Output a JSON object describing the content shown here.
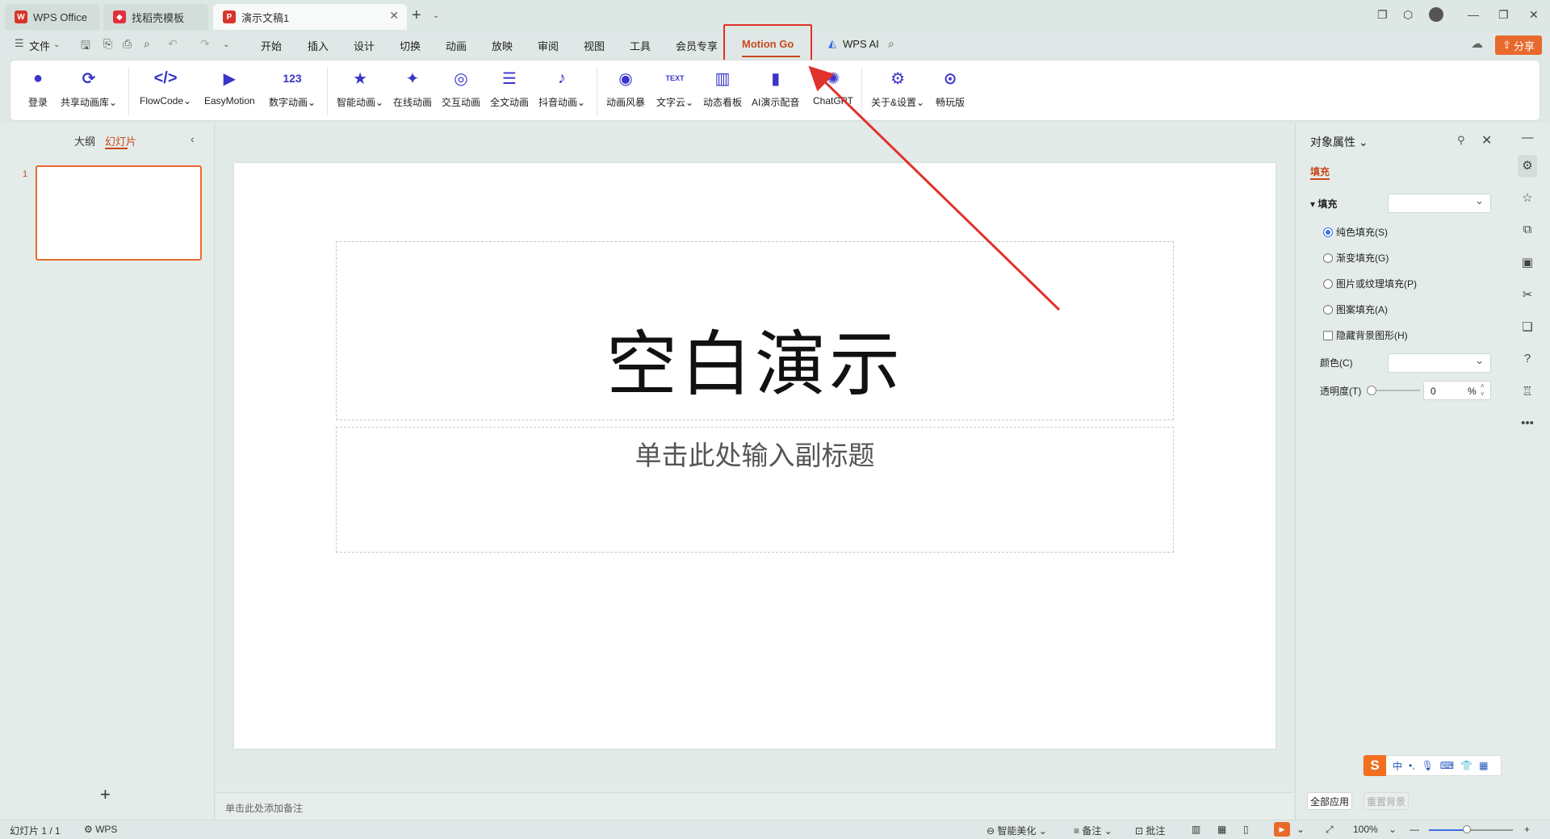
{
  "tabs": [
    {
      "label": "WPS Office",
      "icon": "wps-logo-icon",
      "color": "#d7342b"
    },
    {
      "label": "找稻壳模板",
      "icon": "docer-icon",
      "color": "#e0313b"
    },
    {
      "label": "演示文稿1",
      "icon": "presentation-icon",
      "color": "#d7342b"
    }
  ],
  "menu": {
    "file": "文件",
    "items": [
      "开始",
      "插入",
      "设计",
      "切换",
      "动画",
      "放映",
      "审阅",
      "视图",
      "工具",
      "会员专享"
    ],
    "active": "Motion Go",
    "wps_ai": "WPS AI",
    "share": "分享"
  },
  "ribbon": {
    "groups": [
      [
        {
          "label": "登录",
          "icon": "user-icon"
        },
        {
          "label": "共享动画库",
          "icon": "share-nodes-icon",
          "dropdown": true
        }
      ],
      [
        {
          "label": "FlowCode",
          "icon": "code-icon",
          "dropdown": true
        },
        {
          "label": "EasyMotion",
          "icon": "video-icon"
        },
        {
          "label": "数字动画",
          "icon": "number-icon",
          "dropdown": true
        }
      ],
      [
        {
          "label": "智能动画",
          "icon": "star-icon",
          "dropdown": true
        },
        {
          "label": "在线动画",
          "icon": "online-anim-icon"
        },
        {
          "label": "交互动画",
          "icon": "interactive-icon"
        },
        {
          "label": "全文动画",
          "icon": "fulltext-anim-icon"
        },
        {
          "label": "抖音动画",
          "icon": "tiktok-icon",
          "dropdown": true
        }
      ],
      [
        {
          "label": "动画风暴",
          "icon": "storm-icon"
        },
        {
          "label": "文字云",
          "icon": "text-cloud-icon",
          "dropdown": true
        },
        {
          "label": "动态看板",
          "icon": "dashboard-icon"
        },
        {
          "label": "AI演示配音",
          "icon": "voice-icon"
        },
        {
          "label": "ChatGPT",
          "icon": "chatgpt-icon"
        }
      ],
      [
        {
          "label": "关于&设置",
          "icon": "settings-icon",
          "dropdown": true
        },
        {
          "label": "畅玩版",
          "icon": "toggle-icon"
        }
      ]
    ]
  },
  "left_panel": {
    "tab_outline": "大纲",
    "tab_slides": "幻灯片",
    "slide_number": "1"
  },
  "slide": {
    "title": "空白演示",
    "subtitle": "单击此处输入副标题"
  },
  "notes_placeholder": "单击此处添加备注",
  "properties": {
    "title": "对象属性",
    "tab": "填充",
    "section": "填充",
    "options": [
      "纯色填充(S)",
      "渐变填充(G)",
      "图片或纹理填充(P)",
      "图案填充(A)"
    ],
    "selected_option": "纯色填充(S)",
    "checkbox": "隐藏背景图形(H)",
    "color_label": "颜色(C)",
    "transparency_label": "透明度(T)",
    "transparency_value": "0",
    "transparency_unit": "%",
    "apply_all": "全部应用",
    "reset_bg": "重置背景"
  },
  "ime": {
    "logo": "S",
    "mode": "中"
  },
  "status": {
    "slide_count": "幻灯片 1 / 1",
    "theme": "WPS",
    "smart_beautify": "智能美化",
    "notes": "备注",
    "comments": "批注",
    "zoom": "100%",
    "zoom_fraction": 0.45
  },
  "colors": {
    "accent": "#c9491d",
    "highlight": "#e0312a",
    "ribbon_icon": "#3a35c8"
  }
}
